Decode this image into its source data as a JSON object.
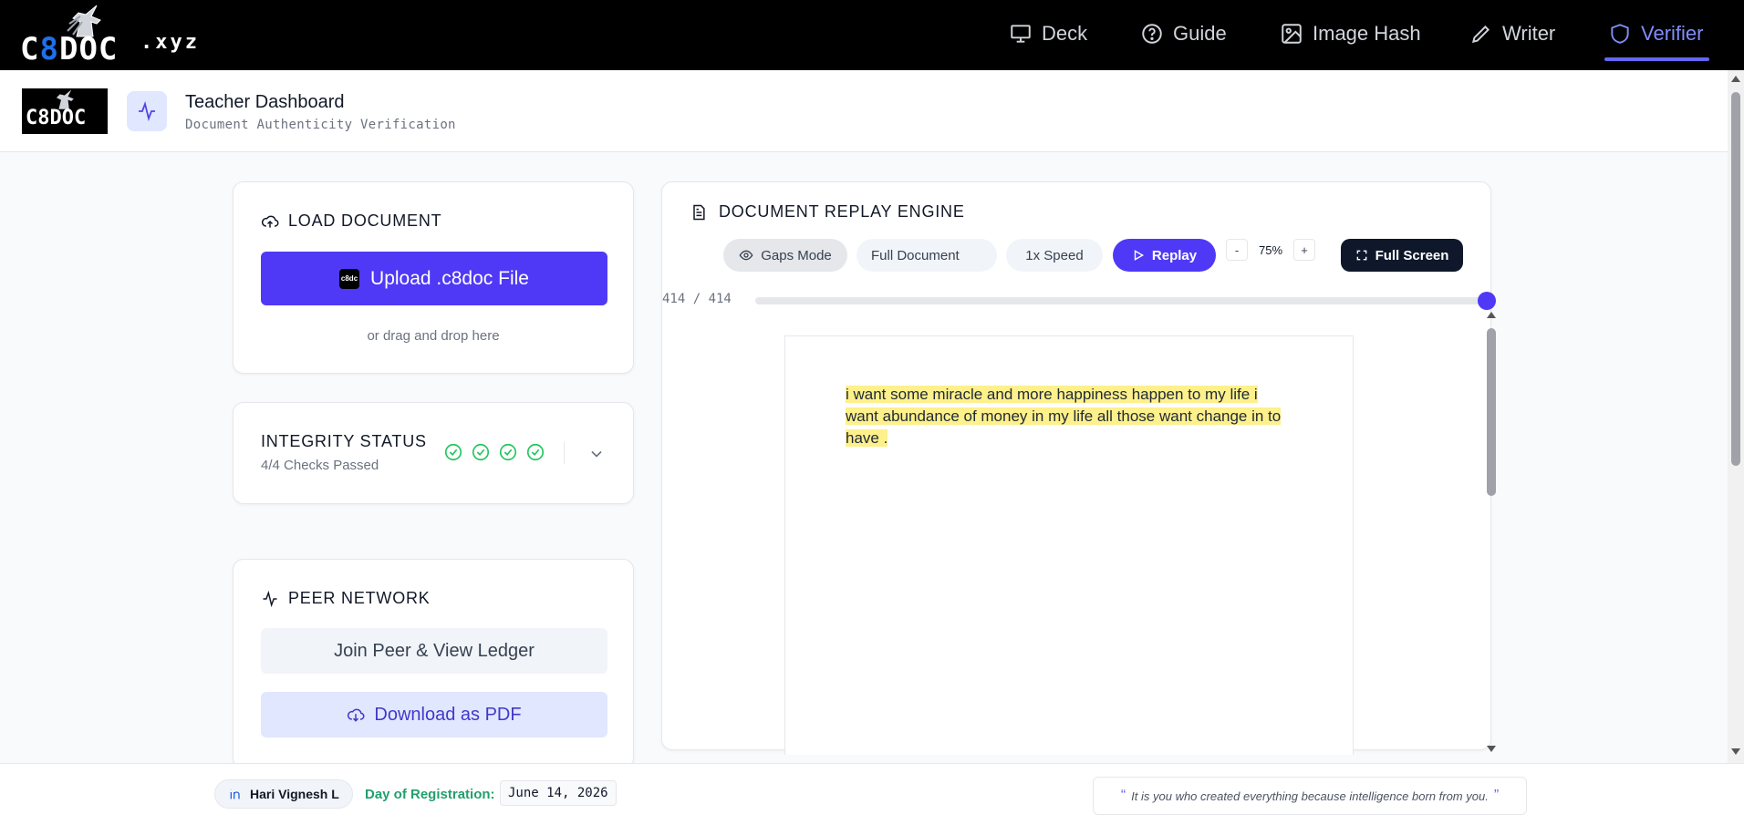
{
  "brand": {
    "logo_main": "C8DOC",
    "logo_suffix": ".xyz"
  },
  "nav": {
    "items": [
      {
        "label": "Deck",
        "icon": "presentation-icon"
      },
      {
        "label": "Guide",
        "icon": "help-circle-icon"
      },
      {
        "label": "Image Hash",
        "icon": "image-icon"
      },
      {
        "label": "Writer",
        "icon": "pen-icon"
      },
      {
        "label": "Verifier",
        "icon": "shield-icon",
        "active": true
      }
    ]
  },
  "header": {
    "logo_text": "C8DOC",
    "title": "Teacher Dashboard",
    "subtitle": "Document Authenticity Verification"
  },
  "load_card": {
    "title": "LOAD DOCUMENT",
    "upload_label": "Upload .c8doc File",
    "upload_mini": "c8dc",
    "drag_text": "or drag and drop here"
  },
  "integrity_card": {
    "title": "INTEGRITY STATUS",
    "subtitle": "4/4 Checks Passed",
    "checks_passed": 4,
    "checks_total": 4
  },
  "peer_card": {
    "title": "PEER NETWORK",
    "join_label": "Join Peer & View Ledger",
    "pdf_label": "Download as PDF"
  },
  "engine": {
    "title": "DOCUMENT REPLAY ENGINE",
    "gaps_mode": "Gaps Mode",
    "scope": "Full Document",
    "speed": "1x Speed",
    "replay": "Replay",
    "zoom_minus": "-",
    "zoom_value": "75%",
    "zoom_plus": "+",
    "fullscreen": "Full Screen",
    "counter": "414 / 414",
    "progress": 1.0,
    "document_text": "i want some miracle and more happiness happen to my life i want abundance of money in my life all those want change in to have ."
  },
  "footer": {
    "name": "Hari Vignesh L",
    "reg_label": "Day of Registration:",
    "reg_date": "June 14, 2026",
    "quote": "It is you who created everything because intelligence born from you."
  },
  "colors": {
    "accent": "#4f39f6",
    "success": "#22c55e",
    "nav_active": "#818cf8",
    "highlight": "#fef08a"
  }
}
